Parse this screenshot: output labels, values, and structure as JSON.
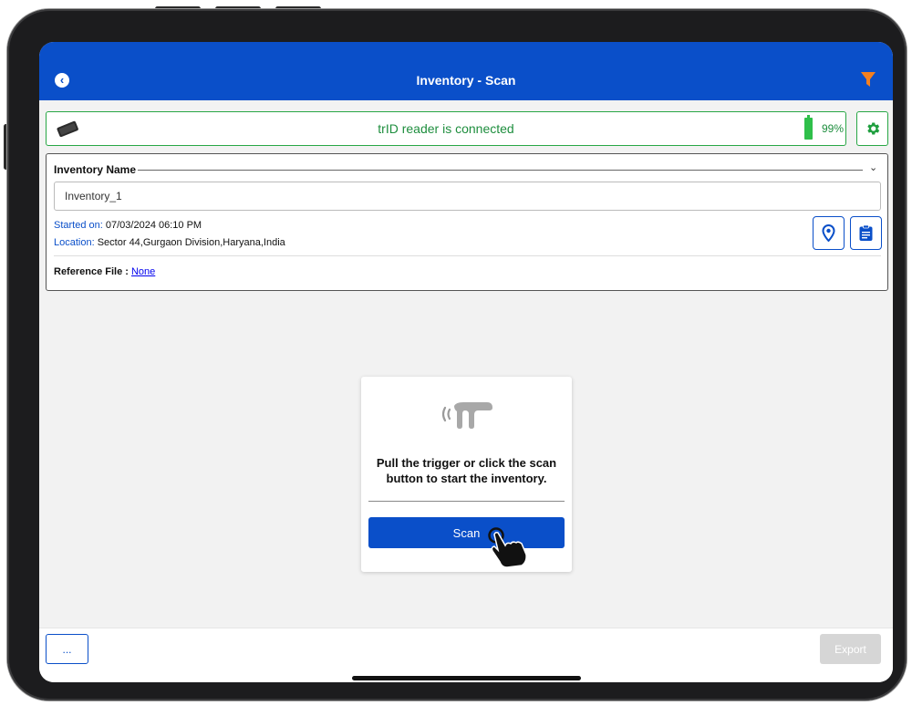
{
  "header": {
    "title": "Inventory - Scan",
    "back_icon": "back-arrow-icon",
    "filter_icon": "funnel-icon",
    "accent": "#0a4fc9",
    "filter_color": "#f4801f"
  },
  "reader": {
    "status": "trID reader is connected",
    "battery_text": "99%",
    "battery_level": 99,
    "status_color": "#1e8e3e"
  },
  "inventory": {
    "name_label": "Inventory Name",
    "name_value": "Inventory_1",
    "started_label": "Started on:",
    "started_value": "07/03/2024 06:10 PM",
    "location_label": "Location:",
    "location_value": "Sector 44,Gurgaon Division,Haryana,India",
    "reference_label": "Reference File :",
    "reference_value": "None"
  },
  "scan_card": {
    "message_line1": "Pull the trigger or click the scan",
    "message_line2": "button to start the inventory.",
    "button_label": "Scan"
  },
  "footer": {
    "more_label": "...",
    "export_label": "Export"
  }
}
